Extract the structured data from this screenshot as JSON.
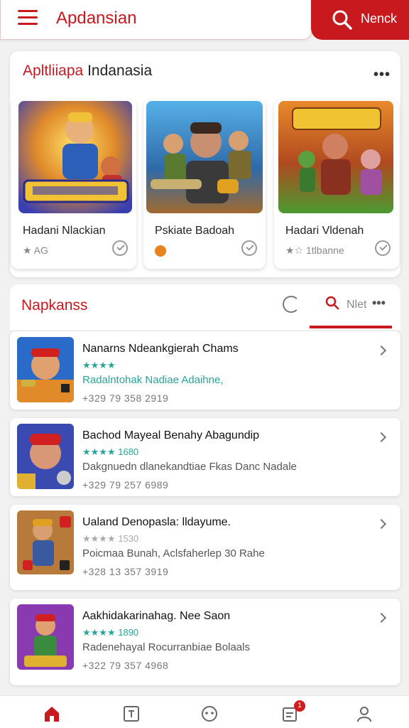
{
  "header": {
    "title": "Apdansian",
    "search_label": "Nenck"
  },
  "featured": {
    "title_accent": "Apltliiapa",
    "title_rest": " Indanasia",
    "games": [
      {
        "name": "Hadani Nlackian",
        "meta": "★ AG"
      },
      {
        "name": "Pskiate Badoah",
        "meta": ""
      },
      {
        "name": "Hadari Vldenah",
        "meta": "★☆ 1tlbanne"
      }
    ]
  },
  "section": {
    "title": "Napkanss",
    "tab_label": "Nlet"
  },
  "list": [
    {
      "title": "Nanarns Ndeankgierah Chams",
      "rating": "★★★★ ",
      "desc": "Radalntohak Nadiae Adaihne,",
      "desc_teal": true,
      "stats": "+329 79 358 2919"
    },
    {
      "title": "Bachod Mayeal Benahy Abagundip",
      "rating": "★★★★ 1680",
      "desc": "Dakgnuedn dlanekandtiae Fkas Danc Nadale",
      "desc_teal": false,
      "stats": "+329 79 257 6989"
    },
    {
      "title": "Ualand Denopasla: lldayume.",
      "rating": "★★★★ 1530",
      "desc": "Poicmaa Bunah, Aclsfaherlep 30 Rahe",
      "desc_teal": false,
      "stats": "+328 13 357 3919"
    },
    {
      "title": "Aakhidakarinahag. Nee Saon",
      "rating": "★★★★ 1890",
      "desc": "Radenehayal Rocurranbiae Bolaals",
      "desc_teal": false,
      "stats": "+322 79 357 4968"
    }
  ],
  "bottom_nav": {
    "badge": "1",
    "active_color": "#c8191f"
  }
}
